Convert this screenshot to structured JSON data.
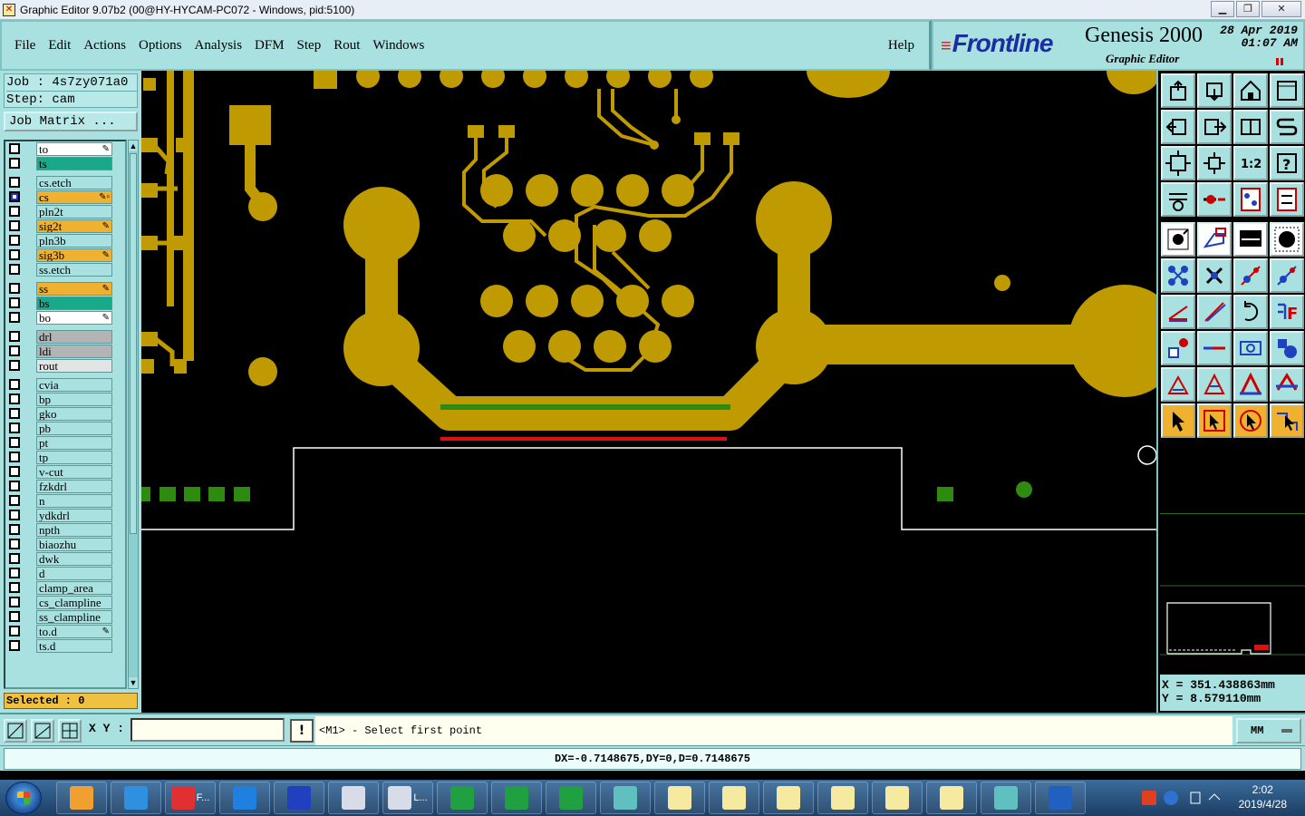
{
  "window": {
    "title": "Graphic Editor 9.07b2 (00@HY-HYCAM-PC072 - Windows, pid:5100)",
    "controls": [
      "▁",
      "❐",
      "✕"
    ]
  },
  "menu": {
    "items": [
      "File",
      "Edit",
      "Actions",
      "Options",
      "Analysis",
      "DFM",
      "Step",
      "Rout",
      "Windows"
    ],
    "help": "Help"
  },
  "brand": {
    "logo": "Frontline",
    "product": "Genesis 2000",
    "subtitle": "Graphic Editor",
    "date": "28 Apr 2019",
    "time": "01:07 AM"
  },
  "job": {
    "job_label": "Job : 4s7zy071a0",
    "step_label": "Step: cam",
    "matrix_button": "Job Matrix ..."
  },
  "layers": [
    {
      "name": "to",
      "bg": "#ffffff",
      "mark": "✎",
      "group": 0
    },
    {
      "name": "ts",
      "bg": "#1aa88a",
      "mark": "",
      "group": 0
    },
    {
      "name": "cs.etch",
      "bg": "#a9e0e0",
      "mark": "",
      "group": 1
    },
    {
      "name": "cs",
      "bg": "#f0b030",
      "mark": "✎▫",
      "group": 1,
      "selected": true
    },
    {
      "name": "pln2t",
      "bg": "#a9e0e0",
      "mark": "",
      "group": 1
    },
    {
      "name": "sig2t",
      "bg": "#f0b030",
      "mark": "✎",
      "group": 1
    },
    {
      "name": "pln3b",
      "bg": "#a9e0e0",
      "mark": "",
      "group": 1
    },
    {
      "name": "sig3b",
      "bg": "#f0b030",
      "mark": "✎",
      "group": 1
    },
    {
      "name": "ss.etch",
      "bg": "#a9e0e0",
      "mark": "",
      "group": 1
    },
    {
      "name": "ss",
      "bg": "#f0b030",
      "mark": "✎",
      "group": 2
    },
    {
      "name": "bs",
      "bg": "#1aa88a",
      "mark": "",
      "group": 2
    },
    {
      "name": "bo",
      "bg": "#ffffff",
      "mark": "✎",
      "group": 2
    },
    {
      "name": "drl",
      "bg": "#b4b4b4",
      "mark": "",
      "group": 3
    },
    {
      "name": "ldi",
      "bg": "#b4b4b4",
      "mark": "",
      "group": 3
    },
    {
      "name": "rout",
      "bg": "#e4e4e4",
      "mark": "",
      "group": 3
    },
    {
      "name": "cvia",
      "bg": "#a9e0e0",
      "mark": "",
      "group": 4
    },
    {
      "name": "bp",
      "bg": "#a9e0e0",
      "mark": "",
      "group": 4
    },
    {
      "name": "gko",
      "bg": "#a9e0e0",
      "mark": "",
      "group": 4
    },
    {
      "name": "pb",
      "bg": "#a9e0e0",
      "mark": "",
      "group": 4
    },
    {
      "name": "pt",
      "bg": "#a9e0e0",
      "mark": "",
      "group": 4
    },
    {
      "name": "tp",
      "bg": "#a9e0e0",
      "mark": "",
      "group": 4
    },
    {
      "name": "v-cut",
      "bg": "#a9e0e0",
      "mark": "",
      "group": 4
    },
    {
      "name": "fzkdrl",
      "bg": "#a9e0e0",
      "mark": "",
      "group": 4
    },
    {
      "name": "n",
      "bg": "#a9e0e0",
      "mark": "",
      "group": 4
    },
    {
      "name": "ydkdrl",
      "bg": "#a9e0e0",
      "mark": "",
      "group": 4
    },
    {
      "name": "npth",
      "bg": "#a9e0e0",
      "mark": "",
      "group": 4
    },
    {
      "name": "biaozhu",
      "bg": "#a9e0e0",
      "mark": "",
      "group": 4
    },
    {
      "name": "dwk",
      "bg": "#a9e0e0",
      "mark": "",
      "group": 4
    },
    {
      "name": "d",
      "bg": "#a9e0e0",
      "mark": "",
      "group": 4
    },
    {
      "name": "clamp_area",
      "bg": "#a9e0e0",
      "mark": "",
      "group": 4
    },
    {
      "name": "cs_clampline",
      "bg": "#a9e0e0",
      "mark": "",
      "group": 4
    },
    {
      "name": "ss_clampline",
      "bg": "#a9e0e0",
      "mark": "",
      "group": 4
    },
    {
      "name": "to.d",
      "bg": "#a9e0e0",
      "mark": "✎",
      "group": 4
    },
    {
      "name": "ts.d",
      "bg": "#a9e0e0",
      "mark": "",
      "group": 4
    }
  ],
  "selected_count": "Selected : 0",
  "colors": {
    "copper": "#bf9a00",
    "mask": "#2e8b10",
    "profile": "#ffffff",
    "highlight": "#e01010"
  },
  "toolbar_icons": [
    "open-icon",
    "save-icon",
    "home-icon",
    "window-icon",
    "left-arrow-icon",
    "right-arrow-icon",
    "mirror-icon",
    "s-icon",
    "fit-icon",
    "zoom-icon",
    "scale-1-2-icon",
    "help-icon",
    "measure-icon",
    "probe-icon",
    "layers-icon",
    "snap-icon",
    "pad-icon",
    "polygon-icon",
    "ruler-icon",
    "circle-icon",
    "node-icon",
    "cross-icon",
    "move-point-icon",
    "line-point-icon",
    "angle-icon",
    "slash-icon",
    "rotate-icon",
    "mirror-f-icon",
    "shape-icon",
    "minus-icon",
    "grid-box-icon",
    "cluster-icon",
    "triangle-icon",
    "triangle-a-icon",
    "triangle-red-icon",
    "triangle-blue-icon",
    "pointer-icon",
    "select-box-icon",
    "select-circle-icon",
    "select-poly-icon"
  ],
  "coords": {
    "x": "X = 351.438863mm",
    "y": "Y = 8.579110mm"
  },
  "command": {
    "xy_label": "X Y :",
    "xy_value": "",
    "bang": "!",
    "prompt": "<M1> - Select first point",
    "units": "MM"
  },
  "measure": "DX=-0.7148675,DY=0,D=0.7148675",
  "taskbar": {
    "items": [
      {
        "label": "",
        "color": "#f0a030"
      },
      {
        "label": "",
        "color": "#3090e0"
      },
      {
        "label": "F...",
        "color": "#e03030"
      },
      {
        "label": "",
        "color": "#2080e0"
      },
      {
        "label": "",
        "color": "#2040c0"
      },
      {
        "label": "",
        "color": "#d8dce8"
      },
      {
        "label": "L...",
        "color": "#d8dce8"
      },
      {
        "label": "",
        "color": "#20a040"
      },
      {
        "label": "",
        "color": "#20a040"
      },
      {
        "label": "",
        "color": "#20a040"
      },
      {
        "label": "",
        "color": "#60c0c0"
      },
      {
        "label": "",
        "color": "#f6e9a0"
      },
      {
        "label": "",
        "color": "#f6e9a0"
      },
      {
        "label": "",
        "color": "#f6e9a0"
      },
      {
        "label": "",
        "color": "#f6e9a0"
      },
      {
        "label": "",
        "color": "#f6e9a0"
      },
      {
        "label": "",
        "color": "#f6e9a0"
      },
      {
        "label": "",
        "color": "#60c0c0"
      },
      {
        "label": "",
        "color": "#2060c0"
      }
    ],
    "time": "2:02",
    "date": "2019/4/28"
  }
}
